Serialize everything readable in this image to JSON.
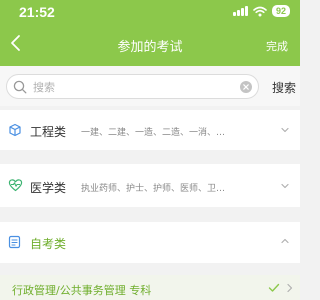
{
  "status": {
    "time": "21:52",
    "battery": "92"
  },
  "nav": {
    "title": "参加的考试",
    "done_label": "完成"
  },
  "search": {
    "placeholder": "搜索",
    "button_label": "搜索"
  },
  "categories": [
    {
      "title": "工程类",
      "subtitle": "一建、二建、一造、二造、一消、…",
      "icon": "cube-icon"
    },
    {
      "title": "医学类",
      "subtitle": "执业药师、护士、护师、医师、卫…",
      "icon": "heartbeat-icon"
    },
    {
      "title": "自考类",
      "subtitle": "",
      "icon": "document-icon"
    }
  ],
  "selected_item": {
    "label": "行政管理/公共事务管理 专科"
  },
  "colors": {
    "accent": "#8cc84b",
    "selected_text": "#6fae2c",
    "selected_bg": "#f2f5ec"
  }
}
